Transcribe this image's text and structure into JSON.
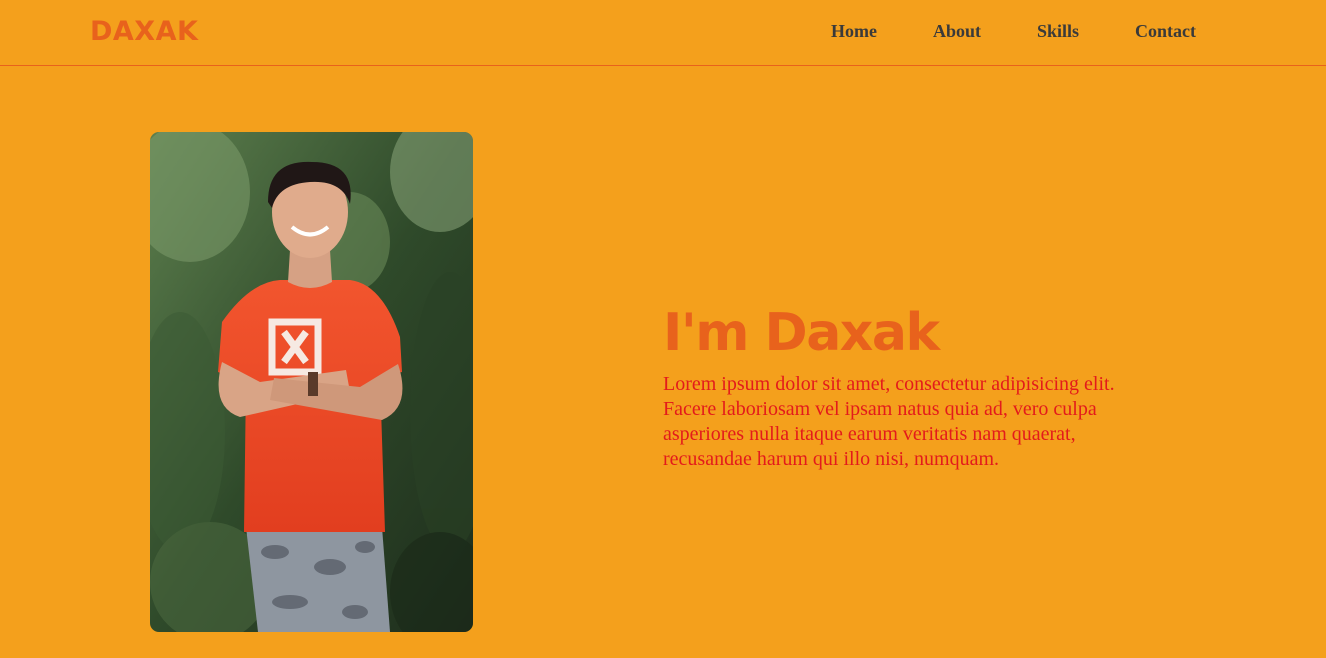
{
  "colors": {
    "background": "#f4a01c",
    "accent": "#e8621c",
    "nav_text": "#3a3a3a",
    "paragraph_text": "#e31b1b"
  },
  "header": {
    "logo": "DAXAK",
    "nav": [
      {
        "label": "Home"
      },
      {
        "label": "About"
      },
      {
        "label": "Skills"
      },
      {
        "label": "Contact"
      }
    ]
  },
  "hero": {
    "title": "I'm Daxak",
    "description": "Lorem ipsum dolor sit amet, consectetur adipisicing elit. Facere laboriosam vel ipsam natus quia ad, vero culpa asperiores nulla itaque earum veritatis nam quaerat, recusandae harum qui illo nisi, numquam."
  }
}
